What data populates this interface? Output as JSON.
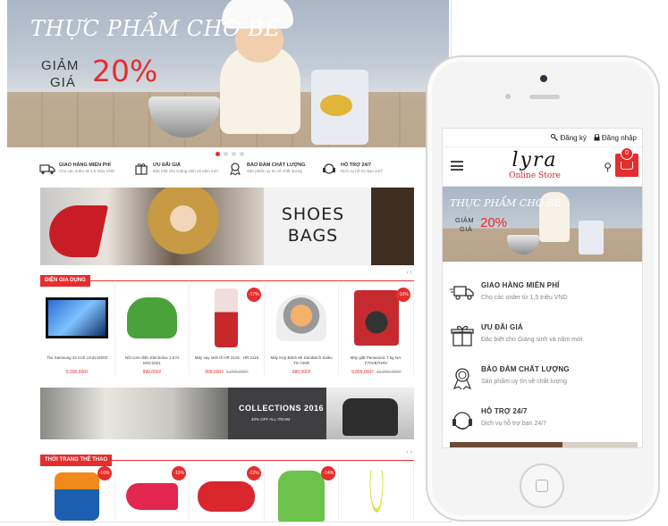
{
  "desktop": {
    "hero": {
      "title": "THỰC PHẨM CHO BÉ",
      "sale_line1": "GIẢM",
      "sale_line2": "GIÁ",
      "percent": "20%"
    },
    "features": [
      {
        "title": "GIAO HÀNG MIỄN PHÍ",
        "sub": "Cho các order từ 1,5 triệu VND",
        "icon": "truck-icon"
      },
      {
        "title": "ƯU ĐÃI GIÁ",
        "sub": "Đặc biệt cho Giáng sinh và năm mới",
        "icon": "gift-icon"
      },
      {
        "title": "BẢO ĐẢM CHẤT LƯỢNG",
        "sub": "Sản phẩm uy tín về chất lượng",
        "icon": "medal-icon"
      },
      {
        "title": "HỖ TRỢ 24/7",
        "sub": "Dịch vụ hỗ trợ bạn 24/7",
        "icon": "headset-icon"
      }
    ],
    "banner_text_line1": "SHOES",
    "banner_text_line2": "BAGS",
    "section1": {
      "title": "ĐIỆN GIA DỤNG",
      "arrows": "‹ ›",
      "products": [
        {
          "name": "Tivi Samsung 32 inch UA32J4003",
          "price": "5,390,000₫",
          "old_price": "",
          "badge": ""
        },
        {
          "name": "Nồi cơm điện Electrolux 1.8 lít ERC1001",
          "price": "990,000₫",
          "old_price": "",
          "badge": ""
        },
        {
          "name": "Máy xay sinh tố HR 2115 - HR 2115",
          "price": "999,000₫",
          "old_price": "1,200,000₫",
          "badge": "-17%"
        },
        {
          "name": "Máy Kẹp Bánh Mì Sandwich Saiko TS-720R",
          "price": "680,000₫",
          "old_price": "",
          "badge": ""
        },
        {
          "name": "Máy giặt Panasonic 7 kg NA-F70VB7HRV",
          "price": "9,899,000₫",
          "old_price": "10,990,000₫",
          "badge": "-10%"
        }
      ]
    },
    "collections": {
      "title": "COLLECTIONS 2016",
      "sub": "40% OFF ALL ITEAM"
    },
    "section2": {
      "title": "THỜI TRANG THỂ THAO",
      "arrows": "‹ ›",
      "badges": [
        "-16%",
        "-10%",
        "-22%",
        "-14%",
        ""
      ]
    }
  },
  "phone": {
    "register": "Đăng ký",
    "login": "Đăng nhập",
    "logo_script": "lyra",
    "logo_sub": "Online Store",
    "cart_count": "0",
    "hero": {
      "title": "THỰC PHẨM CHO BÉ",
      "sale_line1": "GIẢM",
      "sale_line2": "GIÁ",
      "percent": "20%"
    },
    "features": [
      {
        "title": "GIAO HÀNG MIỄN PHÍ",
        "sub": "Cho các order từ 1,5 triệu VND",
        "icon": "truck-icon"
      },
      {
        "title": "ƯU ĐÃI GIÁ",
        "sub": "Đặc biệt cho Giáng sinh và năm mới",
        "icon": "gift-icon"
      },
      {
        "title": "BẢO ĐẢM CHẤT LƯỢNG",
        "sub": "Sản phẩm uy tín về chất lượng",
        "icon": "medal-icon"
      },
      {
        "title": "HỖ TRỢ 24/7",
        "sub": "Dịch vụ hỗ trợ bạn 24/7",
        "icon": "headset-icon"
      }
    ]
  },
  "colors": {
    "accent": "#e52d2d"
  }
}
